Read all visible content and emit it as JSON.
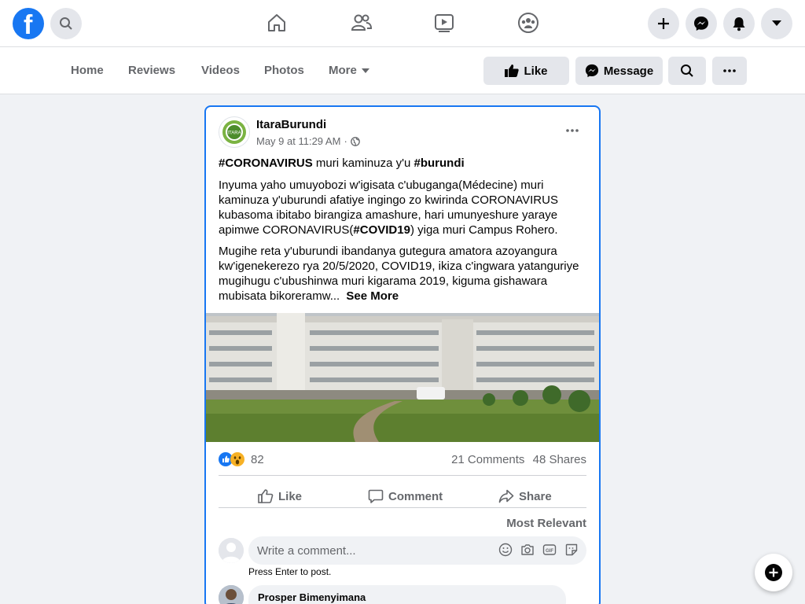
{
  "topbar": {
    "logo": "facebook-logo",
    "logo_letter": "f",
    "icons": [
      "search-icon",
      "home-icon",
      "friends-icon",
      "watch-icon",
      "groups-icon",
      "plus-icon",
      "messenger-icon",
      "notifications-icon",
      "caret-down-icon"
    ]
  },
  "tabs": {
    "home": "Home",
    "reviews": "Reviews",
    "videos": "Videos",
    "photos": "Photos",
    "more": "More"
  },
  "actions": {
    "like": "Like",
    "message": "Message"
  },
  "post": {
    "author": "ItaraBurundi",
    "avatar_text": "ITARA",
    "time": "May 9 at 11:29 AM",
    "separator": "·",
    "line1_tag1": "#CORONAVIRUS",
    "line1_mid": " muri kaminuza y'u ",
    "line1_tag2": "#burundi",
    "para1_a": "Inyuma yaho umuyobozi w'igisata c'ubuganga(Médecine) muri kaminuza y'uburundi afatiye ingingo zo kwirinda CORONAVIRUS kubasoma ibitabo birangiza amashure, hari umunyeshure yaraye apimwe CORONAVIRUS(",
    "para1_tag": "#COVID19",
    "para1_b": ") yiga muri Campus Rohero.",
    "para2": "Mugihe reta y'uburundi ibandanya gutegura amatora azoyangura kw'igenekerezo rya 20/5/2020, COVID19, ikiza c'ingwara yatanguriye mugihugu c'ubushinwa muri kigarama 2019, kiguma gishawara mubisata bikoreramw...",
    "see_more": "See More",
    "reaction_count": "82",
    "comments": "21 Comments",
    "shares": "48 Shares",
    "like": "Like",
    "comment": "Comment",
    "share": "Share",
    "most_relevant": "Most Relevant",
    "comment_placeholder": "Write a comment...",
    "press_enter": "Press Enter to post.",
    "first_commenter": "Prosper Bimenyimana"
  },
  "colors": {
    "brand": "#1877f2",
    "secondary_text": "#65676b",
    "button_gray": "#e4e6eb"
  }
}
